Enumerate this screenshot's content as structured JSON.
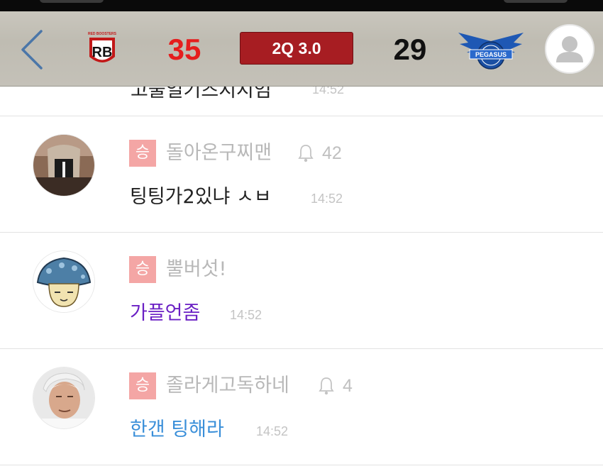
{
  "header": {
    "home_team_logo_text": "RB",
    "home_team_logo_caption": "RED BOOSTERS",
    "home_score": "35",
    "home_score_color": "#e51d1d",
    "quarter": "2Q  3.0",
    "quarter_bg": "#a71d22",
    "away_score": "29",
    "away_score_color": "#111111",
    "away_team_logo_text": "PEGASUS",
    "back_icon": "chevron-left-icon",
    "profile_icon": "user-icon"
  },
  "messages": [
    {
      "partial": true,
      "text": "고물일기즈지지엄",
      "time": "14:52"
    },
    {
      "badge": "승",
      "nickname": "돌아온구찌맨",
      "likes": "42",
      "text": "팅팅가2있냐 ㅅㅂ",
      "text_color": "#222222",
      "time": "14:52",
      "avatar": "masked-person-avatar"
    },
    {
      "badge": "승",
      "nickname": "뿔버섯!",
      "text": "가플언좀",
      "text_color": "#6a1fc4",
      "time": "14:52",
      "avatar": "mushroom-avatar"
    },
    {
      "badge": "승",
      "nickname": "졸라게고독하네",
      "likes": "4",
      "text": "한갠 팅해라",
      "text_color": "#3a8fd9",
      "time": "14:52",
      "avatar": "old-man-avatar"
    }
  ]
}
